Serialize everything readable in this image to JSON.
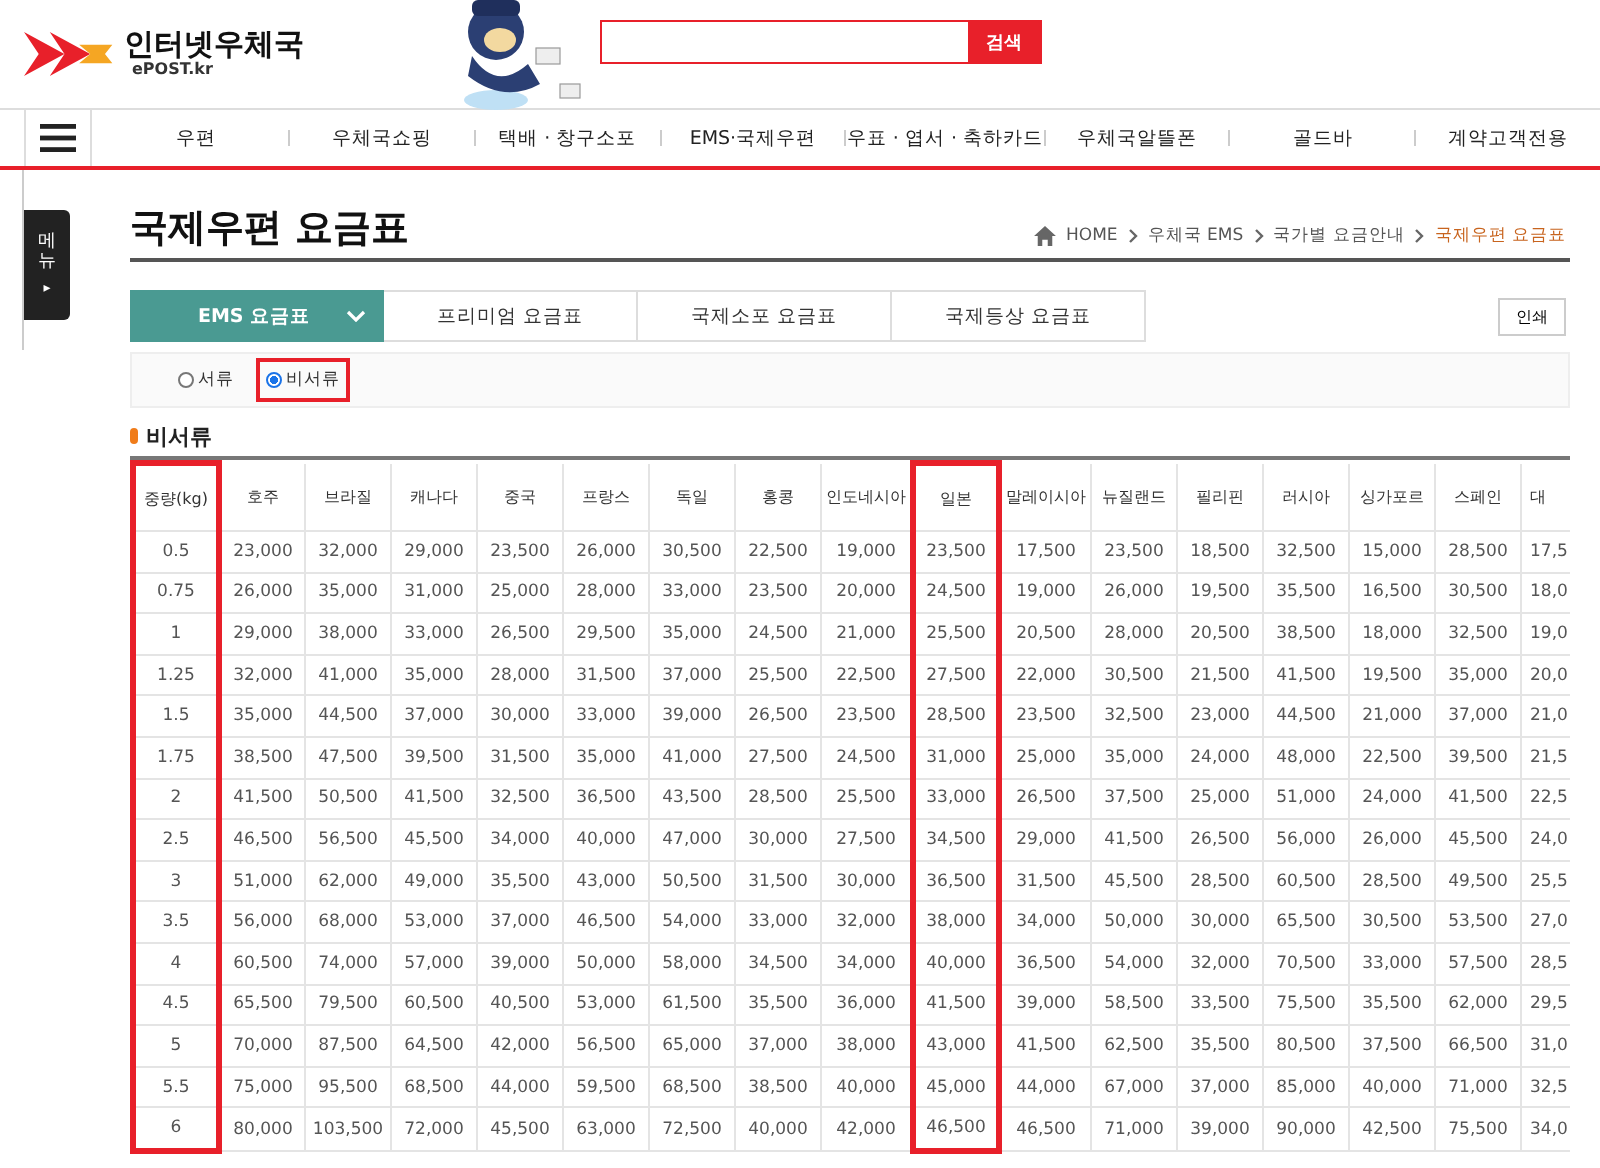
{
  "header": {
    "logo_title": "인터넷우체국",
    "logo_sub": "ePOST.kr",
    "search": {
      "button": "검색"
    }
  },
  "nav": [
    "우편",
    "우체국쇼핑",
    "택배 · 창구소포",
    "EMS·국제우편",
    "우표 · 엽서 · 축하카드",
    "우체국알뜰폰",
    "골드바",
    "계약고객전용"
  ],
  "side_tab": {
    "label": "메뉴",
    "arrow": "▸"
  },
  "title": "국제우편 요금표",
  "breadcrumb": [
    {
      "label": "HOME",
      "current": false
    },
    {
      "label": "우체국 EMS",
      "current": false
    },
    {
      "label": "국가별 요금안내",
      "current": false
    },
    {
      "label": "국제우편 요금표",
      "current": true
    }
  ],
  "tabs": [
    {
      "label": "EMS 요금표",
      "selected": true
    },
    {
      "label": "프리미엄 요금표",
      "selected": false
    },
    {
      "label": "국제소포 요금표",
      "selected": false
    },
    {
      "label": "국제등상 요금표",
      "selected": false
    }
  ],
  "print_button": "인쇄",
  "radios": [
    {
      "label": "서류",
      "selected": false,
      "highlighted": false
    },
    {
      "label": "비서류",
      "selected": true,
      "highlighted": true
    }
  ],
  "section_title": "비서류",
  "table": {
    "columns": [
      {
        "label": "중량(kg)",
        "highlighted": true
      },
      {
        "label": "호주",
        "highlighted": false
      },
      {
        "label": "브라질",
        "highlighted": false
      },
      {
        "label": "캐나다",
        "highlighted": false
      },
      {
        "label": "중국",
        "highlighted": false
      },
      {
        "label": "프랑스",
        "highlighted": false
      },
      {
        "label": "독일",
        "highlighted": false
      },
      {
        "label": "홍콩",
        "highlighted": false
      },
      {
        "label": "인도네시아",
        "highlighted": false
      },
      {
        "label": "일본",
        "highlighted": true
      },
      {
        "label": "말레이시아",
        "highlighted": false
      },
      {
        "label": "뉴질랜드",
        "highlighted": false
      },
      {
        "label": "필리핀",
        "highlighted": false
      },
      {
        "label": "러시아",
        "highlighted": false
      },
      {
        "label": "싱가포르",
        "highlighted": false
      },
      {
        "label": "스페인",
        "highlighted": false
      },
      {
        "label": "대",
        "highlighted": false
      }
    ],
    "rows": [
      [
        "0.5",
        "23,000",
        "32,000",
        "29,000",
        "23,500",
        "26,000",
        "30,500",
        "22,500",
        "19,000",
        "23,500",
        "17,500",
        "23,500",
        "18,500",
        "32,500",
        "15,000",
        "28,500",
        "17,5"
      ],
      [
        "0.75",
        "26,000",
        "35,000",
        "31,000",
        "25,000",
        "28,000",
        "33,000",
        "23,500",
        "20,000",
        "24,500",
        "19,000",
        "26,000",
        "19,500",
        "35,500",
        "16,500",
        "30,500",
        "18,0"
      ],
      [
        "1",
        "29,000",
        "38,000",
        "33,000",
        "26,500",
        "29,500",
        "35,000",
        "24,500",
        "21,000",
        "25,500",
        "20,500",
        "28,000",
        "20,500",
        "38,500",
        "18,000",
        "32,500",
        "19,0"
      ],
      [
        "1.25",
        "32,000",
        "41,000",
        "35,000",
        "28,000",
        "31,500",
        "37,000",
        "25,500",
        "22,500",
        "27,500",
        "22,000",
        "30,500",
        "21,500",
        "41,500",
        "19,500",
        "35,000",
        "20,0"
      ],
      [
        "1.5",
        "35,000",
        "44,500",
        "37,000",
        "30,000",
        "33,000",
        "39,000",
        "26,500",
        "23,500",
        "28,500",
        "23,500",
        "32,500",
        "23,000",
        "44,500",
        "21,000",
        "37,000",
        "21,0"
      ],
      [
        "1.75",
        "38,500",
        "47,500",
        "39,500",
        "31,500",
        "35,000",
        "41,000",
        "27,500",
        "24,500",
        "31,000",
        "25,000",
        "35,000",
        "24,000",
        "48,000",
        "22,500",
        "39,500",
        "21,5"
      ],
      [
        "2",
        "41,500",
        "50,500",
        "41,500",
        "32,500",
        "36,500",
        "43,500",
        "28,500",
        "25,500",
        "33,000",
        "26,500",
        "37,500",
        "25,000",
        "51,000",
        "24,000",
        "41,500",
        "22,5"
      ],
      [
        "2.5",
        "46,500",
        "56,500",
        "45,500",
        "34,000",
        "40,000",
        "47,000",
        "30,000",
        "27,500",
        "34,500",
        "29,000",
        "41,500",
        "26,500",
        "56,000",
        "26,000",
        "45,500",
        "24,0"
      ],
      [
        "3",
        "51,000",
        "62,000",
        "49,000",
        "35,500",
        "43,000",
        "50,500",
        "31,500",
        "30,000",
        "36,500",
        "31,500",
        "45,500",
        "28,500",
        "60,500",
        "28,500",
        "49,500",
        "25,5"
      ],
      [
        "3.5",
        "56,000",
        "68,000",
        "53,000",
        "37,000",
        "46,500",
        "54,000",
        "33,000",
        "32,000",
        "38,000",
        "34,000",
        "50,000",
        "30,000",
        "65,500",
        "30,500",
        "53,500",
        "27,0"
      ],
      [
        "4",
        "60,500",
        "74,000",
        "57,000",
        "39,000",
        "50,000",
        "58,000",
        "34,500",
        "34,000",
        "40,000",
        "36,500",
        "54,000",
        "32,000",
        "70,500",
        "33,000",
        "57,500",
        "28,5"
      ],
      [
        "4.5",
        "65,500",
        "79,500",
        "60,500",
        "40,500",
        "53,000",
        "61,500",
        "35,500",
        "36,000",
        "41,500",
        "39,000",
        "58,500",
        "33,500",
        "75,500",
        "35,500",
        "62,000",
        "29,5"
      ],
      [
        "5",
        "70,000",
        "87,500",
        "64,500",
        "42,000",
        "56,500",
        "65,000",
        "37,000",
        "38,000",
        "43,000",
        "41,500",
        "62,500",
        "35,500",
        "80,500",
        "37,500",
        "66,500",
        "31,0"
      ],
      [
        "5.5",
        "75,000",
        "95,500",
        "68,500",
        "44,000",
        "59,500",
        "68,500",
        "38,500",
        "40,000",
        "45,000",
        "44,000",
        "67,000",
        "37,000",
        "85,000",
        "40,000",
        "71,000",
        "32,5"
      ],
      [
        "6",
        "80,000",
        "103,500",
        "72,000",
        "45,500",
        "63,000",
        "72,500",
        "40,000",
        "42,000",
        "46,500",
        "46,500",
        "71,000",
        "39,000",
        "90,000",
        "42,500",
        "75,500",
        "34,0"
      ]
    ]
  }
}
